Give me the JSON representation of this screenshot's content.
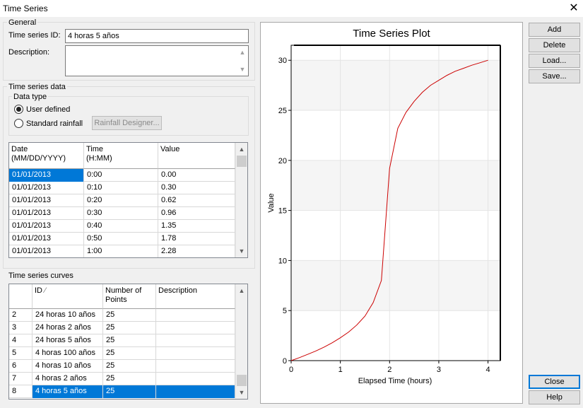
{
  "window": {
    "title": "Time Series"
  },
  "general": {
    "legend": "General",
    "id_label": "Time series ID:",
    "id_value": "4 horas 5 años",
    "desc_label": "Description:",
    "desc_value": ""
  },
  "ts_data": {
    "legend": "Time series data",
    "data_type_legend": "Data type",
    "user_defined": "User defined",
    "standard_rainfall": "Standard rainfall",
    "rainfall_designer": "Rainfall Designer...",
    "selected_type": "User defined",
    "columns": [
      "Date\n(MM/DD/YYYY)",
      "Time\n(H:MM)",
      "Value"
    ],
    "rows": [
      [
        "01/01/2013",
        "0:00",
        "0.00"
      ],
      [
        "01/01/2013",
        "0:10",
        "0.30"
      ],
      [
        "01/01/2013",
        "0:20",
        "0.62"
      ],
      [
        "01/01/2013",
        "0:30",
        "0.96"
      ],
      [
        "01/01/2013",
        "0:40",
        "1.35"
      ],
      [
        "01/01/2013",
        "0:50",
        "1.78"
      ],
      [
        "01/01/2013",
        "1:00",
        "2.28"
      ]
    ]
  },
  "curves": {
    "legend": "Time series curves",
    "columns": [
      "",
      "ID",
      "Number of\nPoints",
      "Description"
    ],
    "rows": [
      [
        "2",
        "24 horas 10 años",
        "25",
        ""
      ],
      [
        "3",
        "24 horas 2 años",
        "25",
        ""
      ],
      [
        "4",
        "24 horas 5 años",
        "25",
        ""
      ],
      [
        "5",
        "4 horas 100 años",
        "25",
        ""
      ],
      [
        "6",
        "4 horas 10 años",
        "25",
        ""
      ],
      [
        "7",
        "4 horas 2 años",
        "25",
        ""
      ],
      [
        "8",
        "4 horas 5 años",
        "25",
        ""
      ]
    ],
    "selected_index": 6
  },
  "buttons": {
    "add": "Add",
    "delete": "Delete",
    "load": "Load...",
    "save": "Save...",
    "close": "Close",
    "help": "Help"
  },
  "icons": {
    "close": "close-icon",
    "scroll_up": "chevron-up-icon",
    "scroll_down": "chevron-down-icon",
    "sort": "sort-indicator-icon"
  },
  "colors": {
    "selection": "#0078d7",
    "series_line": "#cc0000",
    "alt_band": "#f5f5f5"
  },
  "chart_data": {
    "type": "line",
    "title": "Time Series Plot",
    "xlabel": "Elapsed Time (hours)",
    "ylabel": "Value",
    "xlim": [
      0,
      4.25
    ],
    "ylim": [
      0,
      31.5
    ],
    "xticks": [
      "0",
      "1",
      "2",
      "3",
      "4"
    ],
    "yticks": [
      "0",
      "5",
      "10",
      "15",
      "20",
      "25",
      "30"
    ],
    "grid": true,
    "series": [
      {
        "x": [
          0,
          0.167,
          0.333,
          0.5,
          0.667,
          0.833,
          1.0,
          1.167,
          1.333,
          1.5,
          1.667,
          1.833,
          2.0,
          2.167,
          2.333,
          2.5,
          2.667,
          2.833,
          3.0,
          3.167,
          3.333,
          3.5,
          3.667,
          3.833,
          4.0
        ],
        "y": [
          0,
          0.3,
          0.62,
          0.96,
          1.35,
          1.78,
          2.28,
          2.85,
          3.55,
          4.45,
          5.8,
          8.0,
          19.2,
          23.2,
          24.8,
          25.9,
          26.8,
          27.5,
          28.0,
          28.5,
          28.9,
          29.2,
          29.5,
          29.75,
          30.0
        ]
      }
    ]
  }
}
